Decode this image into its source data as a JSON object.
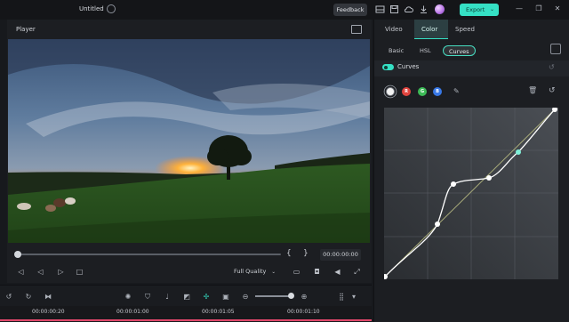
{
  "app": {
    "title": "Untitled",
    "feedback_label": "Feedback",
    "export_label": "Export",
    "export_caret": "⌄",
    "minimize": "—",
    "restore": "❐",
    "close": "✕"
  },
  "player": {
    "label": "Player",
    "timecode": "00:00:00:00",
    "brace_open": "{",
    "brace_close": "}",
    "quality": "Full Quality",
    "quality_caret": "⌄"
  },
  "timeline": {
    "ticks": [
      "00:00:00:20",
      "00:00:01:00",
      "00:00:01:05",
      "00:00:01:10"
    ]
  },
  "right_panel": {
    "tabs": [
      "Video",
      "Color",
      "Speed"
    ],
    "active_tab": "Color",
    "subtabs": [
      "Basic",
      "HSL",
      "Curves"
    ],
    "active_subtab": "Curves",
    "curves_label": "Curves",
    "curves_enabled": true,
    "channels": [
      {
        "key": "W",
        "color": "#f2f2f2",
        "selected": true
      },
      {
        "key": "R",
        "color": "#e0443e"
      },
      {
        "key": "G",
        "color": "#3dbb57"
      },
      {
        "key": "B",
        "color": "#3878e6"
      }
    ]
  },
  "colors": {
    "accent": "#35e0c4",
    "background": "#17191d",
    "panel": "#1c1e22"
  }
}
